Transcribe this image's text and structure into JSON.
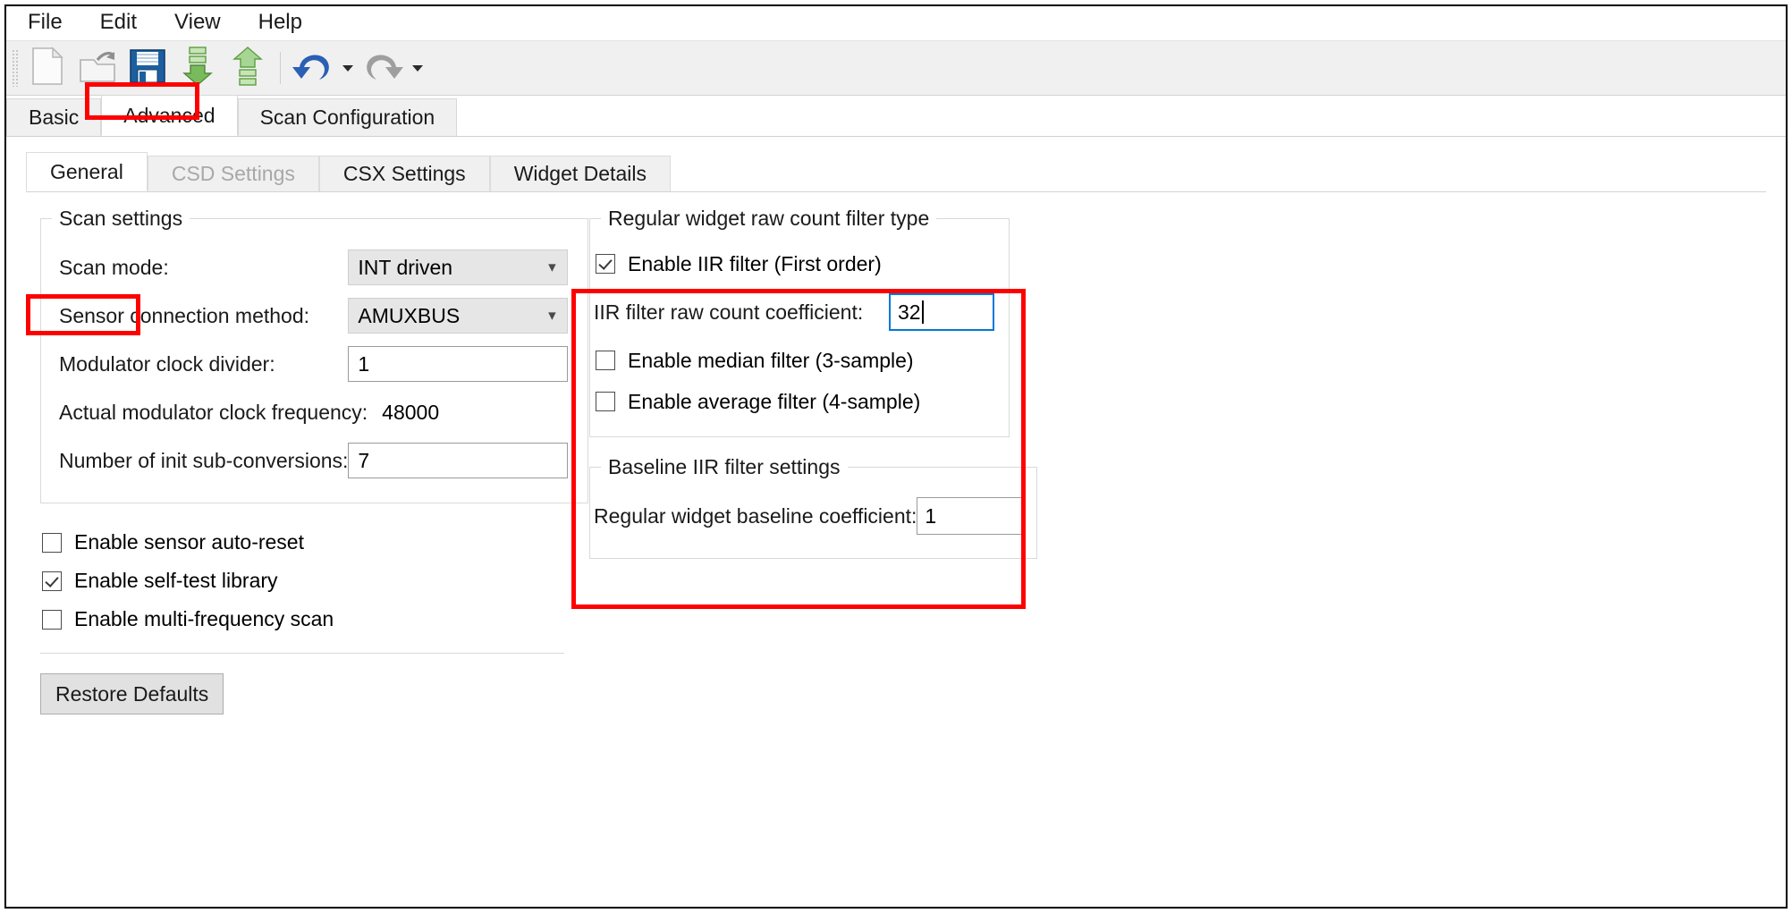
{
  "menubar": {
    "items": [
      {
        "label": "File"
      },
      {
        "label": "Edit"
      },
      {
        "label": "View"
      },
      {
        "label": "Help"
      }
    ]
  },
  "toolbar": {
    "buttons": [
      {
        "name": "new-file-icon",
        "title": "New"
      },
      {
        "name": "open-folder-icon",
        "title": "Open"
      },
      {
        "name": "save-floppy-icon",
        "title": "Save"
      },
      {
        "name": "download-arrow-icon",
        "title": "Apply to Device"
      },
      {
        "name": "upload-arrow-icon",
        "title": "Read from Device"
      },
      {
        "name": "undo-icon",
        "title": "Undo"
      },
      {
        "name": "redo-icon",
        "title": "Redo"
      }
    ]
  },
  "main_tabs": {
    "items": [
      {
        "label": "Basic",
        "selected": false,
        "disabled": false
      },
      {
        "label": "Advanced",
        "selected": true,
        "disabled": false
      },
      {
        "label": "Scan Configuration",
        "selected": false,
        "disabled": false
      }
    ]
  },
  "sub_tabs": {
    "items": [
      {
        "label": "General",
        "selected": true,
        "disabled": false
      },
      {
        "label": "CSD Settings",
        "selected": false,
        "disabled": true
      },
      {
        "label": "CSX Settings",
        "selected": false,
        "disabled": false
      },
      {
        "label": "Widget Details",
        "selected": false,
        "disabled": false
      }
    ]
  },
  "scan_settings": {
    "legend": "Scan settings",
    "scan_mode": {
      "label": "Scan mode:",
      "value": "INT driven"
    },
    "sensor_connection_method": {
      "label": "Sensor connection method:",
      "value": "AMUXBUS"
    },
    "modulator_clock_divider": {
      "label": "Modulator clock divider:",
      "value": "1"
    },
    "actual_modulator_clock_frequency": {
      "label": "Actual modulator clock frequency:",
      "value": "48000"
    },
    "number_of_init_sub_conversions": {
      "label": "Number of init sub-conversions:",
      "value": "7"
    }
  },
  "left_checkboxes": [
    {
      "label": "Enable sensor auto-reset",
      "checked": false
    },
    {
      "label": "Enable self-test library",
      "checked": true
    },
    {
      "label": "Enable multi-frequency scan",
      "checked": false
    }
  ],
  "restore_defaults": {
    "label": "Restore Defaults"
  },
  "raw_count_filter": {
    "legend": "Regular widget raw count filter type",
    "enable_iir": {
      "label": "Enable IIR filter (First order)",
      "checked": true
    },
    "iir_coefficient": {
      "label": "IIR filter raw count coefficient:",
      "value": "32",
      "focused": true
    },
    "enable_median": {
      "label": "Enable median filter (3-sample)",
      "checked": false
    },
    "enable_average": {
      "label": "Enable average filter (4-sample)",
      "checked": false
    }
  },
  "baseline_filter": {
    "legend": "Baseline IIR filter settings",
    "baseline_coefficient": {
      "label": "Regular widget baseline coefficient:",
      "value": "1"
    }
  },
  "annotations": {
    "color": "#ff0000",
    "boxes": [
      {
        "name": "advanced-tab-highlight"
      },
      {
        "name": "general-tab-highlight"
      },
      {
        "name": "filter-settings-highlight"
      }
    ]
  }
}
